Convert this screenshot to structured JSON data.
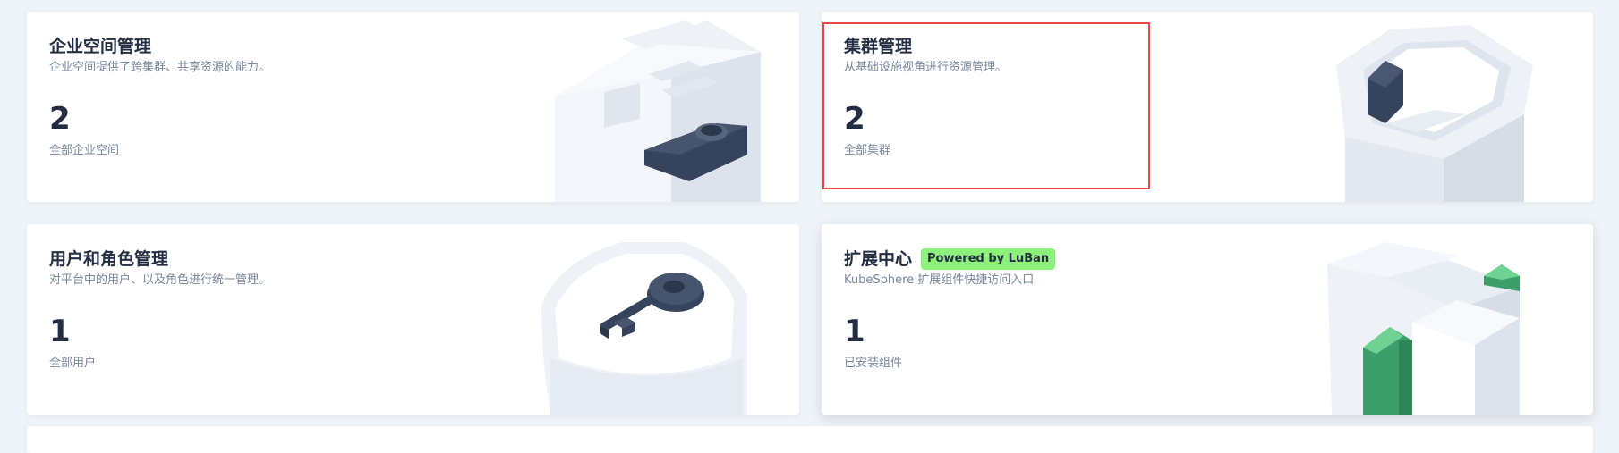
{
  "cards": {
    "workspace": {
      "title": "企业空间管理",
      "description": "企业空间提供了跨集群、共享资源的能力。",
      "count": "2",
      "count_label": "全部企业空间",
      "icon": "workspace-illustration-icon"
    },
    "cluster": {
      "title": "集群管理",
      "description": "从基础设施视角进行资源管理。",
      "count": "2",
      "count_label": "全部集群",
      "icon": "cluster-illustration-icon",
      "highlighted": true
    },
    "users": {
      "title": "用户和角色管理",
      "description": "对平台中的用户、以及角色进行统一管理。",
      "count": "1",
      "count_label": "全部用户",
      "icon": "key-illustration-icon"
    },
    "extensions": {
      "title": "扩展中心",
      "badge": "Powered by LuBan",
      "description": "KubeSphere 扩展组件快捷访问入口",
      "count": "1",
      "count_label": "已安装组件",
      "icon": "extensions-illustration-icon"
    }
  },
  "colors": {
    "background": "#eff4f9",
    "card": "#ffffff",
    "title": "#242e42",
    "muted": "#79879c",
    "badge": "#8bf17a",
    "highlight": "#e8484a",
    "accent_green": "#3c9e6b",
    "dark_slate": "#36435c"
  }
}
